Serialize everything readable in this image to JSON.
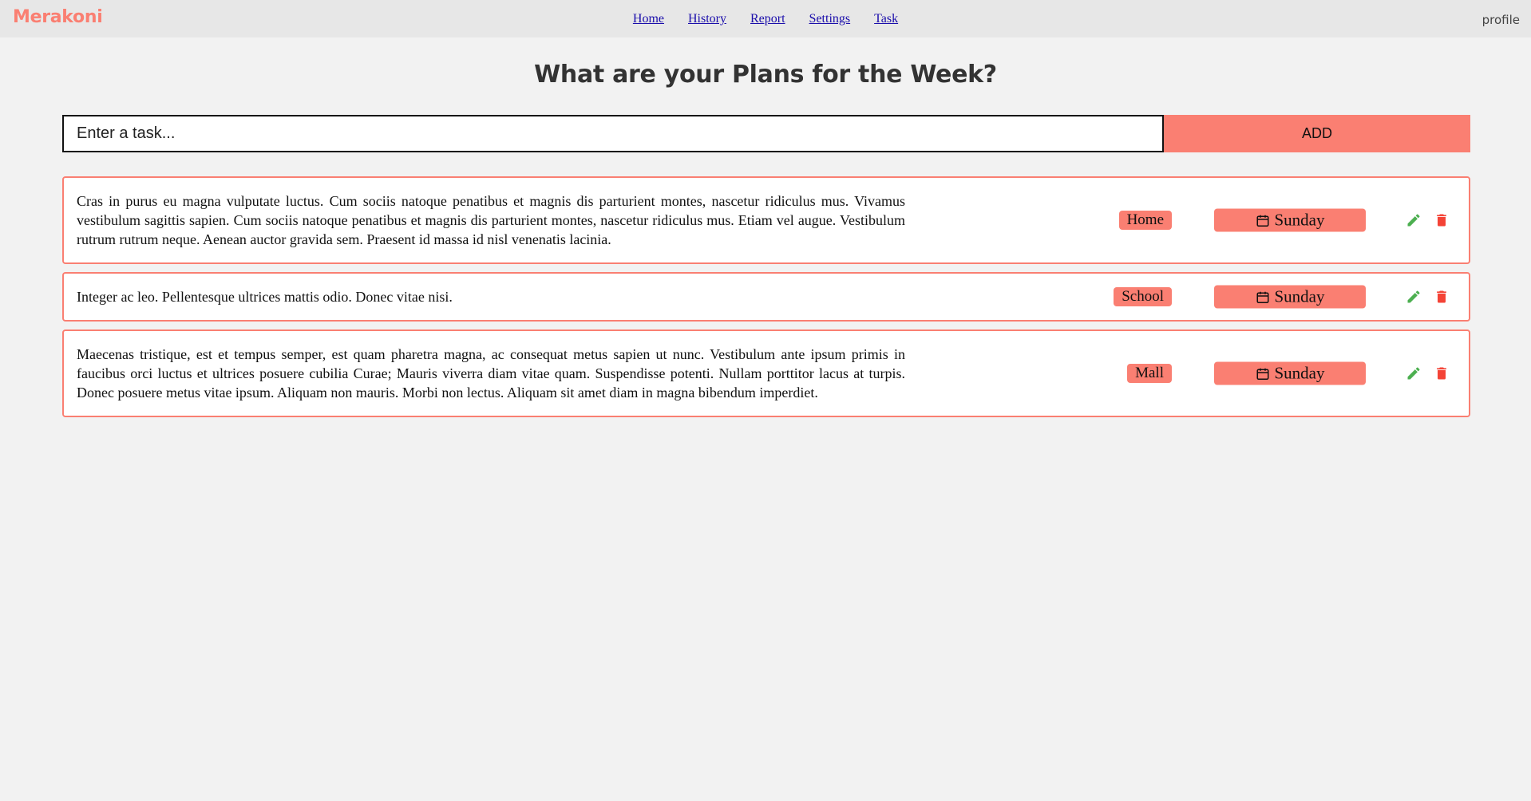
{
  "header": {
    "brand": "Merakoni",
    "nav": [
      "Home",
      "History",
      "Report",
      "Settings",
      "Task"
    ],
    "profile": "profile"
  },
  "main": {
    "title": "What are your Plans for the Week?",
    "input_placeholder": "Enter a task...",
    "add_label": "ADD"
  },
  "tasks": [
    {
      "text": "Cras in purus eu magna vulputate luctus. Cum sociis natoque penatibus et magnis dis parturient montes, nascetur ridiculus mus. Vivamus vestibulum sagittis sapien. Cum sociis natoque penatibus et magnis dis parturient montes, nascetur ridiculus mus. Etiam vel augue. Vestibulum rutrum rutrum neque. Aenean auctor gravida sem. Praesent id massa id nisl venenatis lacinia.",
      "tag": "Home",
      "day": "Sunday"
    },
    {
      "text": "Integer ac leo. Pellentesque ultrices mattis odio. Donec vitae nisi.",
      "tag": "School",
      "day": "Sunday"
    },
    {
      "text": "Maecenas tristique, est et tempus semper, est quam pharetra magna, ac consequat metus sapien ut nunc. Vestibulum ante ipsum primis in faucibus orci luctus et ultrices posuere cubilia Curae; Mauris viverra diam vitae quam. Suspendisse potenti. Nullam porttitor lacus at turpis. Donec posuere metus vitae ipsum. Aliquam non mauris. Morbi non lectus. Aliquam sit amet diam in magna bibendum imperdiet.",
      "tag": "Mall",
      "day": "Sunday"
    }
  ],
  "colors": {
    "accent": "#fa7f72",
    "edit": "#4caf50",
    "delete": "#f44336"
  },
  "icons": {
    "day": "calendar-icon",
    "edit": "pencil-icon",
    "delete": "trash-icon"
  }
}
